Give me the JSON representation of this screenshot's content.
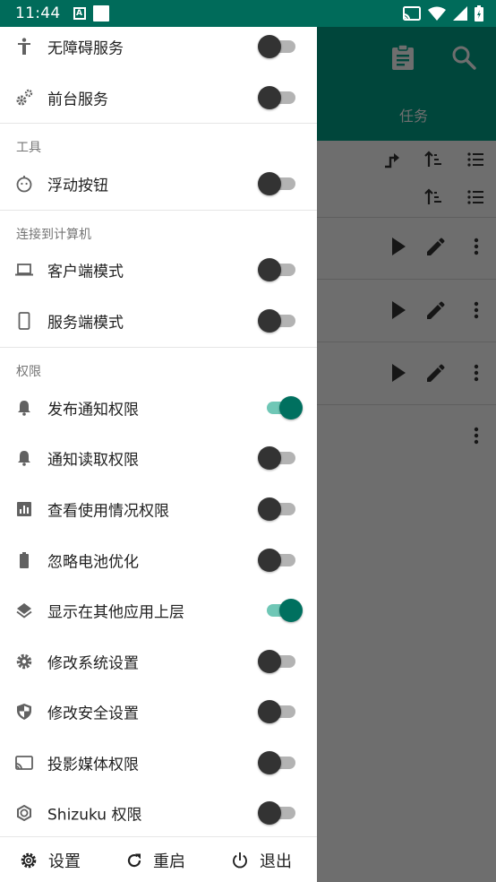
{
  "status_bar": {
    "time": "11:44",
    "notification_a": "A"
  },
  "background_app": {
    "tab_label": "任务"
  },
  "drawer": {
    "top_items": [
      {
        "label": "无障碍服务",
        "icon": "accessibility-icon",
        "enabled": false
      },
      {
        "label": "前台服务",
        "icon": "gears-icon",
        "enabled": false
      }
    ],
    "sections": [
      {
        "header": "工具",
        "items": [
          {
            "label": "浮动按钮",
            "icon": "floating-button-icon",
            "enabled": false
          }
        ]
      },
      {
        "header": "连接到计算机",
        "items": [
          {
            "label": "客户端模式",
            "icon": "laptop-icon",
            "enabled": false
          },
          {
            "label": "服务端模式",
            "icon": "phone-icon",
            "enabled": false
          }
        ]
      },
      {
        "header": "权限",
        "items": [
          {
            "label": "发布通知权限",
            "icon": "bell-icon",
            "enabled": true
          },
          {
            "label": "通知读取权限",
            "icon": "bell-icon",
            "enabled": false
          },
          {
            "label": "查看使用情况权限",
            "icon": "usage-stats-icon",
            "enabled": false
          },
          {
            "label": "忽略电池优化",
            "icon": "battery-icon",
            "enabled": false
          },
          {
            "label": "显示在其他应用上层",
            "icon": "layers-icon",
            "enabled": true
          },
          {
            "label": "修改系统设置",
            "icon": "gear-icon",
            "enabled": false
          },
          {
            "label": "修改安全设置",
            "icon": "shield-icon",
            "enabled": false
          },
          {
            "label": "投影媒体权限",
            "icon": "cast-icon",
            "enabled": false
          },
          {
            "label": "Shizuku 权限",
            "icon": "shizuku-icon",
            "enabled": false
          }
        ]
      }
    ],
    "bottom": {
      "settings_label": "设置",
      "restart_label": "重启",
      "exit_label": "退出"
    }
  },
  "colors": {
    "status_bar": "#006b5a",
    "app_bar": "#00a38a",
    "switch_on_thumb": "#00705f",
    "switch_on_track": "#6fc7b6"
  }
}
